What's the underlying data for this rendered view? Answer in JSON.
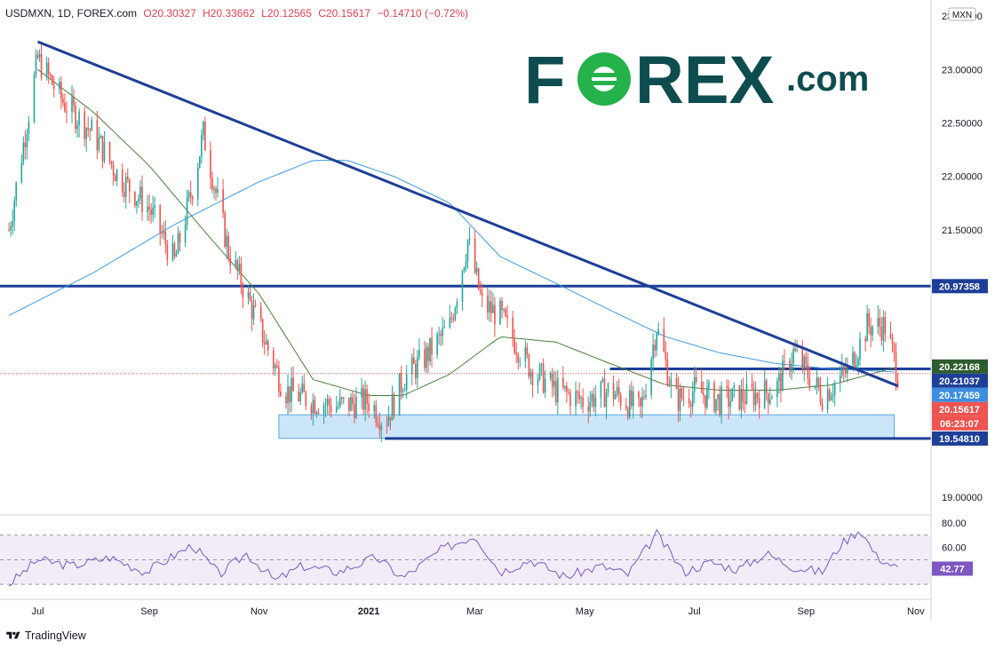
{
  "header": {
    "symbol": "USDMXN, 1D, FOREX.com",
    "open": "O20.30327",
    "high": "H20.33662",
    "low": "L20.12565",
    "close": "C20.15617",
    "change": "−0.14710 (−0.72%)"
  },
  "currency_label": "MXN",
  "logo": {
    "text_left": "F",
    "text_right": "REX",
    "suffix": ".com"
  },
  "footer": {
    "brand": "TradingView"
  },
  "colors": {
    "up": "#26a69a",
    "down": "#ef5350",
    "trend": "#1e3f97",
    "ma_blue": "#3d9be0",
    "ma_green": "#4a7f3b",
    "rsi": "#7e57c2",
    "zone": "#bfe0f7",
    "logo_dark": "#0e4d4f",
    "logo_green": "#26b24a"
  },
  "chart_data": {
    "type": "candlestick",
    "symbol": "USDMXN",
    "timeframe": "1D",
    "ylim": [
      18.85,
      23.65
    ],
    "y_ticks": [
      "23.50000",
      "23.00000",
      "22.50000",
      "22.00000",
      "21.50000",
      "19.00000"
    ],
    "x_ticks": [
      "Jul",
      "Sep",
      "Nov",
      "2021",
      "Mar",
      "May",
      "Jul",
      "Sep",
      "Nov"
    ],
    "price_labels": [
      {
        "text": "20.97358",
        "value": 20.97358,
        "style": "navy"
      },
      {
        "text": "20.22168",
        "value": 20.22168,
        "style": "green"
      },
      {
        "text": "20.21037",
        "value": 20.21037,
        "style": "navy"
      },
      {
        "text": "20.17459",
        "value": 20.17459,
        "style": "blue"
      },
      {
        "text": "20.15617",
        "value": 20.15617,
        "style": "red"
      },
      {
        "text": "06:23:07",
        "value": 20.035,
        "style": "red"
      },
      {
        "text": "19.54810",
        "value": 19.5481,
        "style": "navy"
      }
    ],
    "horizontal_levels": [
      20.97358,
      19.5481
    ],
    "support_segment": {
      "from": "2021-05-15",
      "value": 20.2
    },
    "demand_zone": {
      "from": "2020-11-12",
      "to": "2021-10-20",
      "low": 19.55,
      "high": 19.77
    },
    "trendline": {
      "from": {
        "date": "2020-07-01",
        "value": 23.26
      },
      "to": {
        "date": "2021-10-22",
        "value": 20.04
      }
    },
    "series": [
      {
        "name": "close",
        "dates": [
          "2020-06-15",
          "2020-07-01",
          "2020-07-15",
          "2020-08-01",
          "2020-08-15",
          "2020-09-01",
          "2020-09-15",
          "2020-09-25",
          "2020-10-01",
          "2020-10-15",
          "2020-11-01",
          "2020-11-15",
          "2020-12-01",
          "2020-12-15",
          "2021-01-01",
          "2021-01-10",
          "2021-01-20",
          "2021-02-01",
          "2021-02-15",
          "2021-02-25",
          "2021-03-05",
          "2021-03-15",
          "2021-04-01",
          "2021-04-15",
          "2021-05-01",
          "2021-05-15",
          "2021-06-01",
          "2021-06-10",
          "2021-06-20",
          "2021-07-01",
          "2021-07-15",
          "2021-08-01",
          "2021-08-15",
          "2021-08-25",
          "2021-09-10",
          "2021-09-25",
          "2021-10-05",
          "2021-10-15",
          "2021-10-22"
        ],
        "values": [
          21.5,
          23.1,
          22.7,
          22.4,
          22.0,
          21.7,
          21.2,
          21.9,
          22.4,
          21.3,
          20.6,
          20.0,
          19.9,
          19.85,
          19.9,
          19.7,
          20.1,
          20.3,
          20.6,
          21.4,
          20.8,
          20.7,
          20.2,
          20.0,
          19.9,
          20.0,
          19.8,
          20.6,
          19.9,
          20.0,
          19.9,
          19.95,
          20.0,
          20.35,
          19.95,
          20.2,
          20.6,
          20.6,
          20.156
        ]
      },
      {
        "name": "ma_blue",
        "dates": [
          "2020-06-15",
          "2020-08-01",
          "2020-09-15",
          "2020-11-01",
          "2020-12-01",
          "2020-12-20",
          "2021-01-15",
          "2021-02-15",
          "2021-03-15",
          "2021-04-15",
          "2021-05-15",
          "2021-06-15",
          "2021-07-15",
          "2021-08-15",
          "2021-09-15",
          "2021-10-22"
        ],
        "values": [
          20.7,
          21.1,
          21.55,
          21.95,
          22.15,
          22.15,
          22.0,
          21.75,
          21.25,
          21.0,
          20.75,
          20.5,
          20.35,
          20.25,
          20.2,
          20.17
        ]
      },
      {
        "name": "ma_green",
        "dates": [
          "2020-07-01",
          "2020-08-01",
          "2020-09-01",
          "2020-10-01",
          "2020-11-01",
          "2020-12-01",
          "2021-01-01",
          "2021-01-20",
          "2021-02-15",
          "2021-03-15",
          "2021-04-15",
          "2021-05-15",
          "2021-06-15",
          "2021-07-15",
          "2021-08-15",
          "2021-09-15",
          "2021-10-22"
        ],
        "values": [
          23.0,
          22.6,
          22.1,
          21.5,
          20.9,
          20.1,
          19.95,
          19.95,
          20.15,
          20.5,
          20.45,
          20.25,
          20.05,
          20.0,
          20.0,
          20.05,
          20.22
        ]
      },
      {
        "name": "rsi",
        "ylim": [
          20,
          85
        ],
        "y_ticks": [
          "80.00",
          "60.00"
        ],
        "last": "42.77",
        "levels": [
          70,
          30
        ],
        "dates": [
          "2020-06-15",
          "2020-07-01",
          "2020-07-20",
          "2020-08-10",
          "2020-08-30",
          "2020-09-25",
          "2020-10-10",
          "2020-10-25",
          "2020-11-10",
          "2020-11-25",
          "2020-12-15",
          "2021-01-05",
          "2021-01-20",
          "2021-02-10",
          "2021-03-01",
          "2021-03-15",
          "2021-04-01",
          "2021-04-20",
          "2021-05-10",
          "2021-05-25",
          "2021-06-10",
          "2021-06-25",
          "2021-07-10",
          "2021-07-25",
          "2021-08-10",
          "2021-08-25",
          "2021-09-10",
          "2021-09-20",
          "2021-10-01",
          "2021-10-10",
          "2021-10-22"
        ],
        "values": [
          30,
          50,
          45,
          52,
          40,
          62,
          38,
          55,
          33,
          45,
          40,
          52,
          35,
          58,
          70,
          40,
          50,
          36,
          45,
          38,
          71,
          40,
          48,
          42,
          55,
          44,
          40,
          62,
          75,
          53,
          42.77
        ]
      }
    ]
  }
}
